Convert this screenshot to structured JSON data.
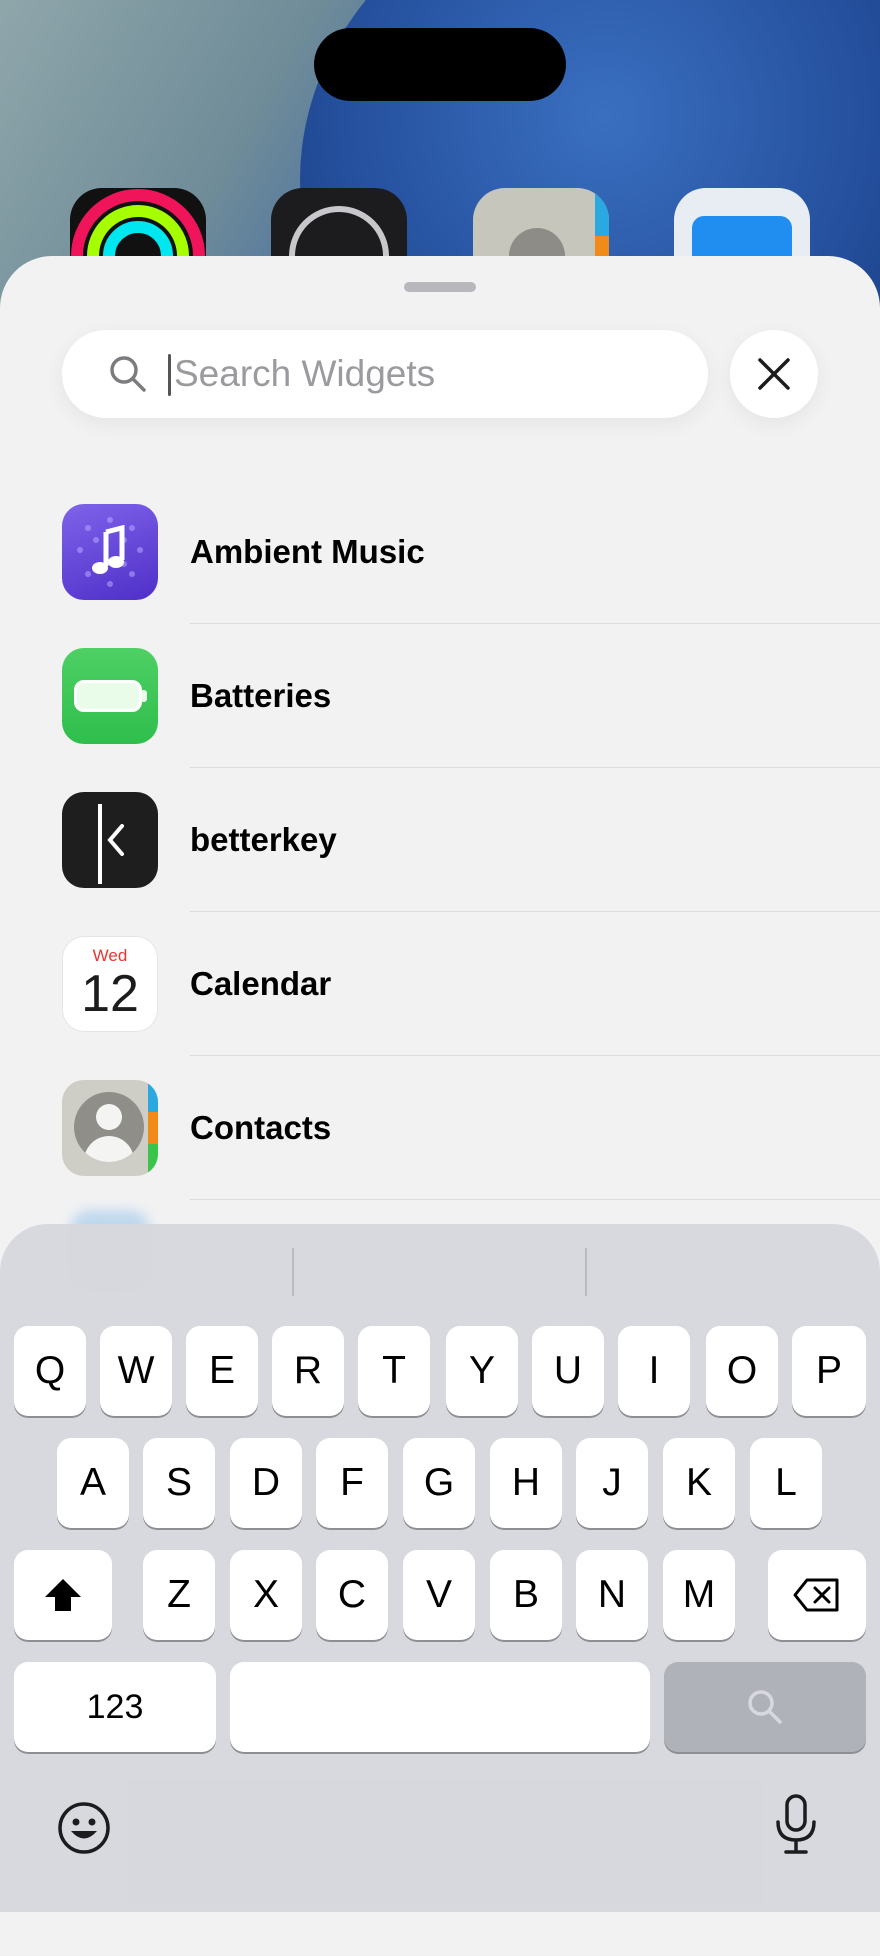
{
  "search": {
    "placeholder": "Search Widgets"
  },
  "apps": [
    {
      "name": "Ambient Music",
      "icon": "ambient-music-icon"
    },
    {
      "name": "Batteries",
      "icon": "batteries-icon"
    },
    {
      "name": "betterkey",
      "icon": "betterkey-icon"
    },
    {
      "name": "Calendar",
      "icon": "calendar-icon",
      "icon_day": "Wed",
      "icon_date": "12"
    },
    {
      "name": "Contacts",
      "icon": "contacts-icon"
    }
  ],
  "keyboard": {
    "row1": [
      "Q",
      "W",
      "E",
      "R",
      "T",
      "Y",
      "U",
      "I",
      "O",
      "P"
    ],
    "row2": [
      "A",
      "S",
      "D",
      "F",
      "G",
      "H",
      "J",
      "K",
      "L"
    ],
    "row3": [
      "Z",
      "X",
      "C",
      "V",
      "B",
      "N",
      "M"
    ],
    "numbers_key": "123"
  },
  "colors": {
    "accent_red": "#e8372f",
    "sheet_bg": "#f2f2f3",
    "keyboard_bg": "#d6d7dd"
  }
}
